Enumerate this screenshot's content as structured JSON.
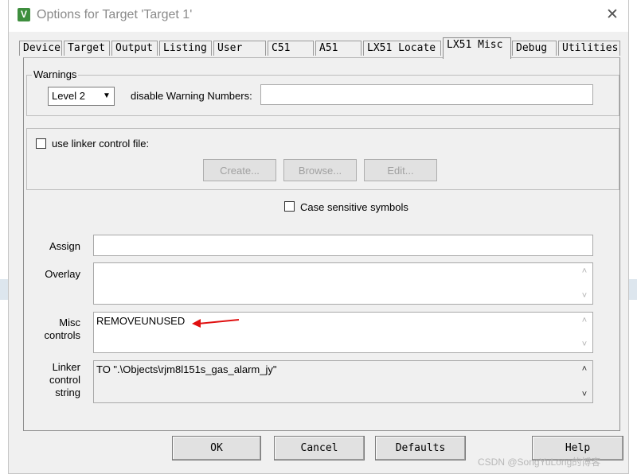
{
  "window": {
    "title": "Options for Target 'Target 1'",
    "app_icon_glyph": "V",
    "close_glyph": "✕"
  },
  "tabs": [
    {
      "label": "Device"
    },
    {
      "label": "Target"
    },
    {
      "label": "Output"
    },
    {
      "label": "Listing"
    },
    {
      "label": "User"
    },
    {
      "label": "C51"
    },
    {
      "label": "A51"
    },
    {
      "label": "LX51 Locate"
    },
    {
      "label": "LX51 Misc",
      "active": true
    },
    {
      "label": "Debug"
    },
    {
      "label": "Utilities"
    }
  ],
  "warnings": {
    "group_label": "Warnings",
    "level_value": "Level 2",
    "disable_label": "disable Warning Numbers:",
    "disable_value": ""
  },
  "linker_control": {
    "checkbox_label": "use linker control file:",
    "checked": false,
    "create_button": "Create...",
    "browse_button": "Browse...",
    "edit_button": "Edit..."
  },
  "case_sensitive": {
    "label": "Case sensitive symbols",
    "checked": false
  },
  "fields": {
    "assign_label": "Assign",
    "assign_value": "",
    "overlay_label": "Overlay",
    "overlay_value": "",
    "misc_label_line1": "Misc",
    "misc_label_line2": "controls",
    "misc_value": "REMOVEUNUSED",
    "linker_label_line1": "Linker",
    "linker_label_line2": "control",
    "linker_label_line3": "string",
    "linker_string_value": "TO \".\\Objects\\rjm8l151s_gas_alarm_jy\""
  },
  "buttons": {
    "ok": "OK",
    "cancel": "Cancel",
    "defaults": "Defaults",
    "help": "Help"
  },
  "watermark": "CSDN @SongYuLong的博客",
  "annotation": {
    "arrow_color": "#e01010"
  },
  "icons": {
    "up_arrow": "▲",
    "down_arrow": "▼",
    "chevron_up": "˄",
    "chevron_down": "˅"
  }
}
